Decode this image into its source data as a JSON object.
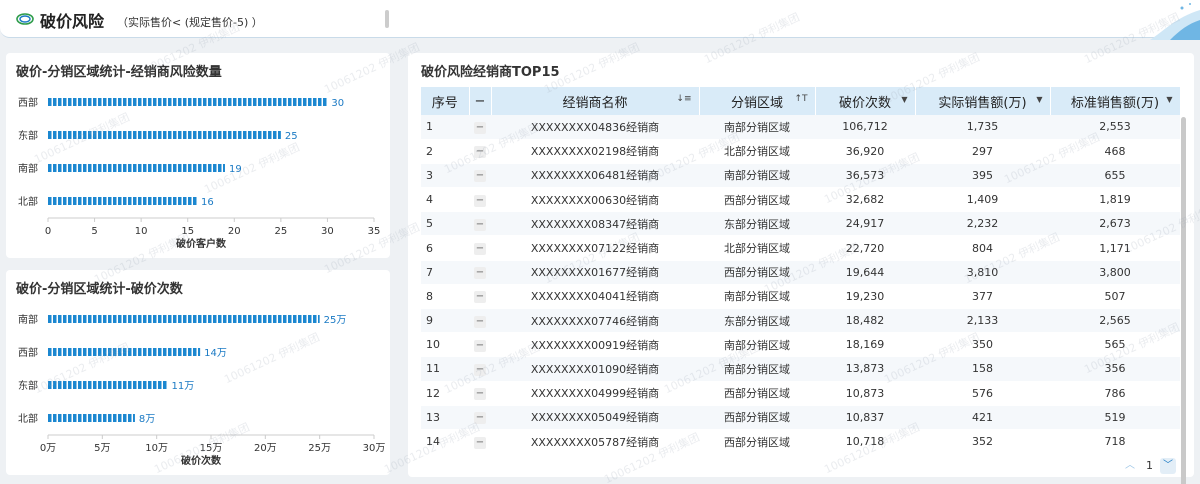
{
  "header": {
    "title": "破价风险",
    "subtitle": "（实际售价< (规定售价-5) ）"
  },
  "watermark_text": "10061202 伊利集团",
  "chart1": {
    "title": "破价-分销区域统计-经销商风险数量",
    "chart_data": {
      "type": "bar",
      "orientation": "horizontal",
      "categories": [
        "西部",
        "东部",
        "南部",
        "北部"
      ],
      "values": [
        30,
        25,
        19,
        16
      ],
      "value_labels": [
        "30",
        "25",
        "19",
        "16"
      ],
      "xlabel": "破价客户数",
      "xlim": [
        0,
        35
      ],
      "xticks": [
        "0",
        "5",
        "10",
        "15",
        "20",
        "25",
        "30",
        "35"
      ],
      "bar_color": "#1b87d0"
    }
  },
  "chart2": {
    "title": "破价-分销区域统计-破价次数",
    "chart_data": {
      "type": "bar",
      "orientation": "horizontal",
      "categories": [
        "南部",
        "西部",
        "东部",
        "北部"
      ],
      "values": [
        25,
        14,
        11,
        8
      ],
      "value_labels": [
        "25万",
        "14万",
        "11万",
        "8万"
      ],
      "xlabel": "破价次数",
      "xlim": [
        0,
        30
      ],
      "xticks": [
        "0万",
        "5万",
        "10万",
        "15万",
        "20万",
        "25万",
        "30万"
      ],
      "bar_color": "#1b87d0"
    }
  },
  "table": {
    "title": "破价风险经销商TOP15",
    "headers": {
      "idx": "序号",
      "dash": "−",
      "name": "经销商名称",
      "region": "分销区域",
      "count": "破价次数",
      "actual": "实际销售额(万)",
      "standard": "标准销售额(万)"
    },
    "rows": [
      [
        "1",
        "−",
        "XXXXXXXX04836经销商",
        "南部分销区域",
        "106,712",
        "1,735",
        "2,553"
      ],
      [
        "2",
        "−",
        "XXXXXXXX02198经销商",
        "北部分销区域",
        "36,920",
        "297",
        "468"
      ],
      [
        "3",
        "−",
        "XXXXXXXX06481经销商",
        "南部分销区域",
        "36,573",
        "395",
        "655"
      ],
      [
        "4",
        "−",
        "XXXXXXXX00630经销商",
        "西部分销区域",
        "32,682",
        "1,409",
        "1,819"
      ],
      [
        "5",
        "−",
        "XXXXXXXX08347经销商",
        "东部分销区域",
        "24,917",
        "2,232",
        "2,673"
      ],
      [
        "6",
        "−",
        "XXXXXXXX07122经销商",
        "北部分销区域",
        "22,720",
        "804",
        "1,171"
      ],
      [
        "7",
        "−",
        "XXXXXXXX01677经销商",
        "西部分销区域",
        "19,644",
        "3,810",
        "3,800"
      ],
      [
        "8",
        "−",
        "XXXXXXXX04041经销商",
        "南部分销区域",
        "19,230",
        "377",
        "507"
      ],
      [
        "9",
        "−",
        "XXXXXXXX07746经销商",
        "东部分销区域",
        "18,482",
        "2,133",
        "2,565"
      ],
      [
        "10",
        "−",
        "XXXXXXXX00919经销商",
        "南部分销区域",
        "18,169",
        "350",
        "565"
      ],
      [
        "11",
        "−",
        "XXXXXXXX01090经销商",
        "南部分销区域",
        "13,873",
        "158",
        "356"
      ],
      [
        "12",
        "−",
        "XXXXXXXX04999经销商",
        "西部分销区域",
        "10,873",
        "576",
        "786"
      ],
      [
        "13",
        "−",
        "XXXXXXXX05049经销商",
        "西部分销区域",
        "10,837",
        "421",
        "519"
      ],
      [
        "14",
        "−",
        "XXXXXXXX05787经销商",
        "西部分销区域",
        "10,718",
        "352",
        "718"
      ]
    ],
    "pager": {
      "page": "1"
    }
  }
}
